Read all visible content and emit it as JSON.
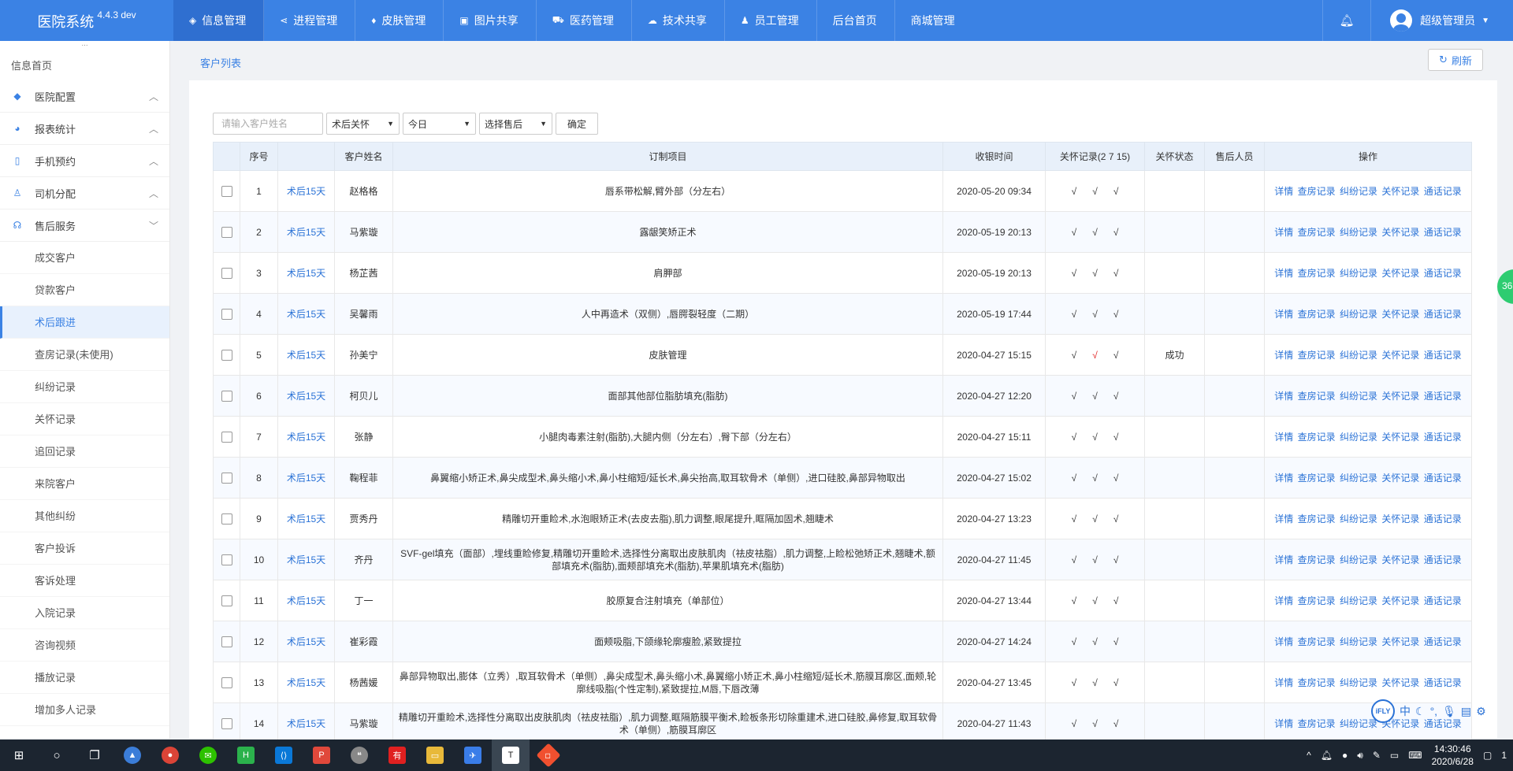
{
  "app": {
    "title": "医院系统",
    "version": "4.4.3 dev"
  },
  "nav": [
    {
      "label": "信息管理",
      "icon": "compass-icon"
    },
    {
      "label": "进程管理",
      "icon": "share-icon"
    },
    {
      "label": "皮肤管理",
      "icon": "diamond-icon"
    },
    {
      "label": "图片共享",
      "icon": "image-icon"
    },
    {
      "label": "医药管理",
      "icon": "cart-icon"
    },
    {
      "label": "技术共享",
      "icon": "cloud-icon"
    },
    {
      "label": "员工管理",
      "icon": "users-icon"
    },
    {
      "label": "后台首页",
      "icon": ""
    },
    {
      "label": "商城管理",
      "icon": ""
    }
  ],
  "user": {
    "name": "超级管理员"
  },
  "sidebar": {
    "dots": "...",
    "home": "信息首页",
    "groups": [
      {
        "label": "医院配置",
        "icon": "layers-icon"
      },
      {
        "label": "报表统计",
        "icon": "pie-chart-icon"
      },
      {
        "label": "手机预约",
        "icon": "mobile-icon"
      },
      {
        "label": "司机分配",
        "icon": "user-icon"
      },
      {
        "label": "售后服务",
        "icon": "headset-icon"
      }
    ],
    "items": [
      "成交客户",
      "贷款客户",
      "术后跟进",
      "查房记录(未使用)",
      "纠纷记录",
      "关怀记录",
      "追回记录",
      "来院客户",
      "其他纠纷",
      "客户投诉",
      "客诉处理",
      "入院记录",
      "咨询视频",
      "播放记录",
      "增加多人记录"
    ]
  },
  "page": {
    "breadcrumb": "客户列表",
    "refresh": "刷新"
  },
  "filters": {
    "name_placeholder": "请输入客户姓名",
    "type": "术后关怀",
    "date": "今日",
    "aftersale": "选择售后",
    "confirm": "确定"
  },
  "table": {
    "headers": [
      "",
      "序号",
      "",
      "客户姓名",
      "订制项目",
      "收银时间",
      "关怀记录(2 7 15)",
      "关怀状态",
      "售后人员",
      "操作"
    ],
    "ops": [
      "详情",
      "查房记录",
      "纠纷记录",
      "关怀记录",
      "通话记录"
    ],
    "rows": [
      {
        "no": "1",
        "tag": "术后15天",
        "name": "赵格格",
        "project": "唇系带松解,臂外部（分左右）",
        "time": "2020-05-20 09:34",
        "status": ""
      },
      {
        "no": "2",
        "tag": "术后15天",
        "name": "马紫璇",
        "project": "露龈笑矫正术",
        "time": "2020-05-19 20:13",
        "status": ""
      },
      {
        "no": "3",
        "tag": "术后15天",
        "name": "杨芷茜",
        "project": "肩胛部",
        "time": "2020-05-19 20:13",
        "status": ""
      },
      {
        "no": "4",
        "tag": "术后15天",
        "name": "吴馨雨",
        "project": "人中再造术（双侧）,唇腭裂轻度（二期）",
        "time": "2020-05-19 17:44",
        "status": ""
      },
      {
        "no": "5",
        "tag": "术后15天",
        "name": "孙美宁",
        "project": "皮肤管理",
        "time": "2020-04-27 15:15",
        "status": "成功"
      },
      {
        "no": "6",
        "tag": "术后15天",
        "name": "柯贝儿",
        "project": "面部其他部位脂肪填充(脂肪)",
        "time": "2020-04-27 12:20",
        "status": ""
      },
      {
        "no": "7",
        "tag": "术后15天",
        "name": "张静",
        "project": "小腿肉毒素注射(脂肪),大腿内侧（分左右）,臀下部（分左右）",
        "time": "2020-04-27 15:11",
        "status": ""
      },
      {
        "no": "8",
        "tag": "术后15天",
        "name": "鞠程菲",
        "project": "鼻翼缩小矫正术,鼻尖成型术,鼻头缩小术,鼻小柱缩短/延长术,鼻尖抬高,取耳软骨术（单侧）,进口硅胶,鼻部异物取出",
        "time": "2020-04-27 15:02",
        "status": ""
      },
      {
        "no": "9",
        "tag": "术后15天",
        "name": "贾秀丹",
        "project": "精雕切开重睑术,水泡眼矫正术(去皮去脂),肌力调整,眼尾提升,眶隔加固术,翘睫术",
        "time": "2020-04-27 13:23",
        "status": ""
      },
      {
        "no": "10",
        "tag": "术后15天",
        "name": "齐丹",
        "project": "SVF-gel填充（面部）,埋线重睑修复,精雕切开重睑术,选择性分离取出皮肤肌肉（祛皮祛脂）,肌力调整,上睑松弛矫正术,翘睫术,额部填充术(脂肪),面颊部填充术(脂肪),苹果肌填充术(脂肪)",
        "time": "2020-04-27 11:45",
        "status": ""
      },
      {
        "no": "11",
        "tag": "术后15天",
        "name": "丁一",
        "project": "胶原复合注射填充（单部位）",
        "time": "2020-04-27 13:44",
        "status": ""
      },
      {
        "no": "12",
        "tag": "术后15天",
        "name": "崔彩霞",
        "project": "面颊吸脂,下颌缘轮廓瘦脸,紧致提拉",
        "time": "2020-04-27 14:24",
        "status": ""
      },
      {
        "no": "13",
        "tag": "术后15天",
        "name": "杨茜媛",
        "project": "鼻部异物取出,膨体（立秀）,取耳软骨术（单侧）,鼻尖成型术,鼻头缩小术,鼻翼缩小矫正术,鼻小柱缩短/延长术,筋膜耳廓区,面颊,轮廓线吸脂(个性定制),紧致提拉,M唇,下唇改薄",
        "time": "2020-04-27 13:45",
        "status": ""
      },
      {
        "no": "14",
        "tag": "术后15天",
        "name": "马紫璇",
        "project": "精雕切开重睑术,选择性分离取出皮肤肌肉（祛皮祛脂）,肌力调整,眶隔筋膜平衡术,睑板条形切除重建术,进口硅胶,鼻修复,取耳软骨术（单侧）,筋膜耳廓区",
        "time": "2020-04-27 11:43",
        "status": ""
      }
    ],
    "check_mark": "√"
  },
  "float_badge": "36",
  "ime": {
    "logo": "iFLY",
    "mode": "中"
  },
  "taskbar": {
    "time": "14:30:46",
    "date": "2020/6/28",
    "notif": "1"
  },
  "colors": {
    "primary": "#3b82e4",
    "link": "#2a72d6",
    "taskbar": "#1c2530",
    "alert_check": "#e02020"
  }
}
